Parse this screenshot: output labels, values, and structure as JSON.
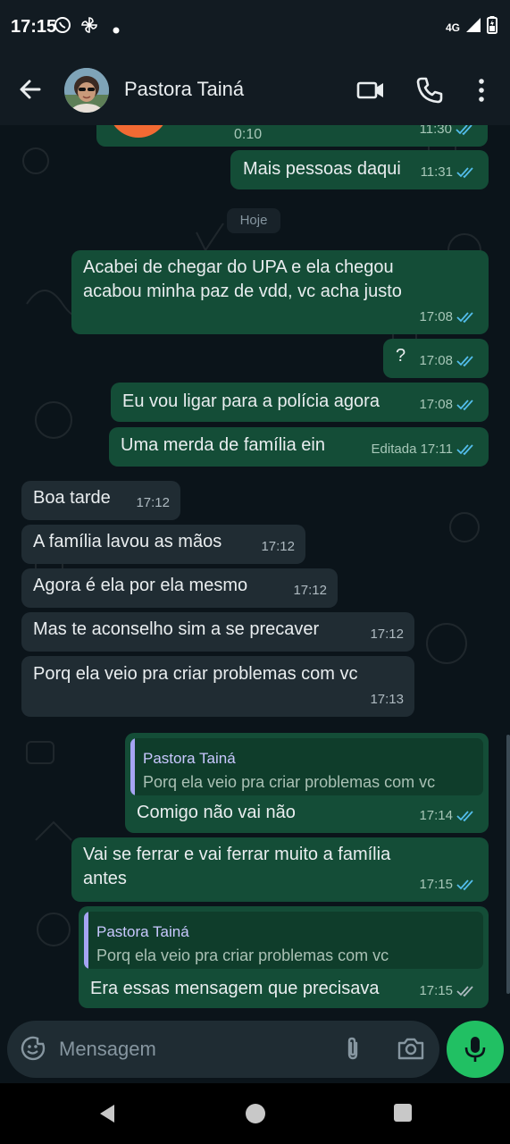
{
  "status_bar": {
    "time": "17:15",
    "network": "4G",
    "icons": [
      "whatsapp-icon",
      "pinwheel-icon",
      "dot-icon",
      "signal-icon",
      "battery-icon"
    ]
  },
  "header": {
    "contact_name": "Pastora Tainá",
    "icons": [
      "back-arrow-icon",
      "video-call-icon",
      "phone-icon",
      "more-vert-icon"
    ]
  },
  "chat": {
    "top_partial": {
      "duration": "0:10",
      "time": "11:30"
    },
    "day_chip": "Hoje",
    "messages": [
      {
        "dir": "out",
        "text": "Mais pessoas daqui",
        "time": "11:31",
        "status": "read"
      },
      {
        "dir": "out",
        "text_lines": [
          "Acabei de chegar do UPA e ela chegou",
          "acabou minha paz de vdd, vc acha justo"
        ],
        "time": "17:08",
        "status": "read"
      },
      {
        "dir": "out",
        "text": "?",
        "time": "17:08",
        "status": "read"
      },
      {
        "dir": "out",
        "text": "Eu vou ligar para a polícia agora",
        "time": "17:08",
        "status": "read"
      },
      {
        "dir": "out",
        "text": "Uma merda de família ein",
        "time": "Editada 17:11",
        "status": "read"
      },
      {
        "dir": "in",
        "text": "Boa tarde",
        "time": "17:12"
      },
      {
        "dir": "in",
        "text": "A família lavou as mãos",
        "time": "17:12"
      },
      {
        "dir": "in",
        "text": "Agora é ela por ela mesmo",
        "time": "17:12"
      },
      {
        "dir": "in",
        "text": "Mas te aconselho sim a se precaver",
        "time": "17:12"
      },
      {
        "dir": "in",
        "text": "Porq ela veio pra criar problemas com vc",
        "time": "17:13"
      },
      {
        "dir": "out",
        "reply_name": "Pastora Tainá",
        "reply_text": "Porq ela veio pra criar problemas com vc",
        "text": "Comigo não vai não",
        "time": "17:14",
        "status": "read"
      },
      {
        "dir": "out",
        "text_lines": [
          "Vai se ferrar e vai ferrar muito a família",
          "antes"
        ],
        "time": "17:15",
        "status": "read"
      },
      {
        "dir": "out",
        "reply_name": "Pastora Tainá",
        "reply_text": "Porq ela veio pra criar problemas com vc",
        "text": "Era essas mensagem que precisava",
        "time": "17:15",
        "status": "delivered"
      }
    ]
  },
  "input": {
    "placeholder": "Mensagem",
    "icons": [
      "emoji-icon",
      "paperclip-icon",
      "camera-icon",
      "mic-icon"
    ]
  },
  "navbar": {
    "icons": [
      "nav-back-icon",
      "nav-home-icon",
      "nav-recents-icon"
    ]
  },
  "colors": {
    "background": "#0b141a",
    "header": "#121b22",
    "outgoing_bubble": "#144d37",
    "incoming_bubble": "#202c33",
    "read_ticks": "#53bdeb",
    "accent": "#21c063",
    "quote_bar": "#a5a4f3"
  }
}
